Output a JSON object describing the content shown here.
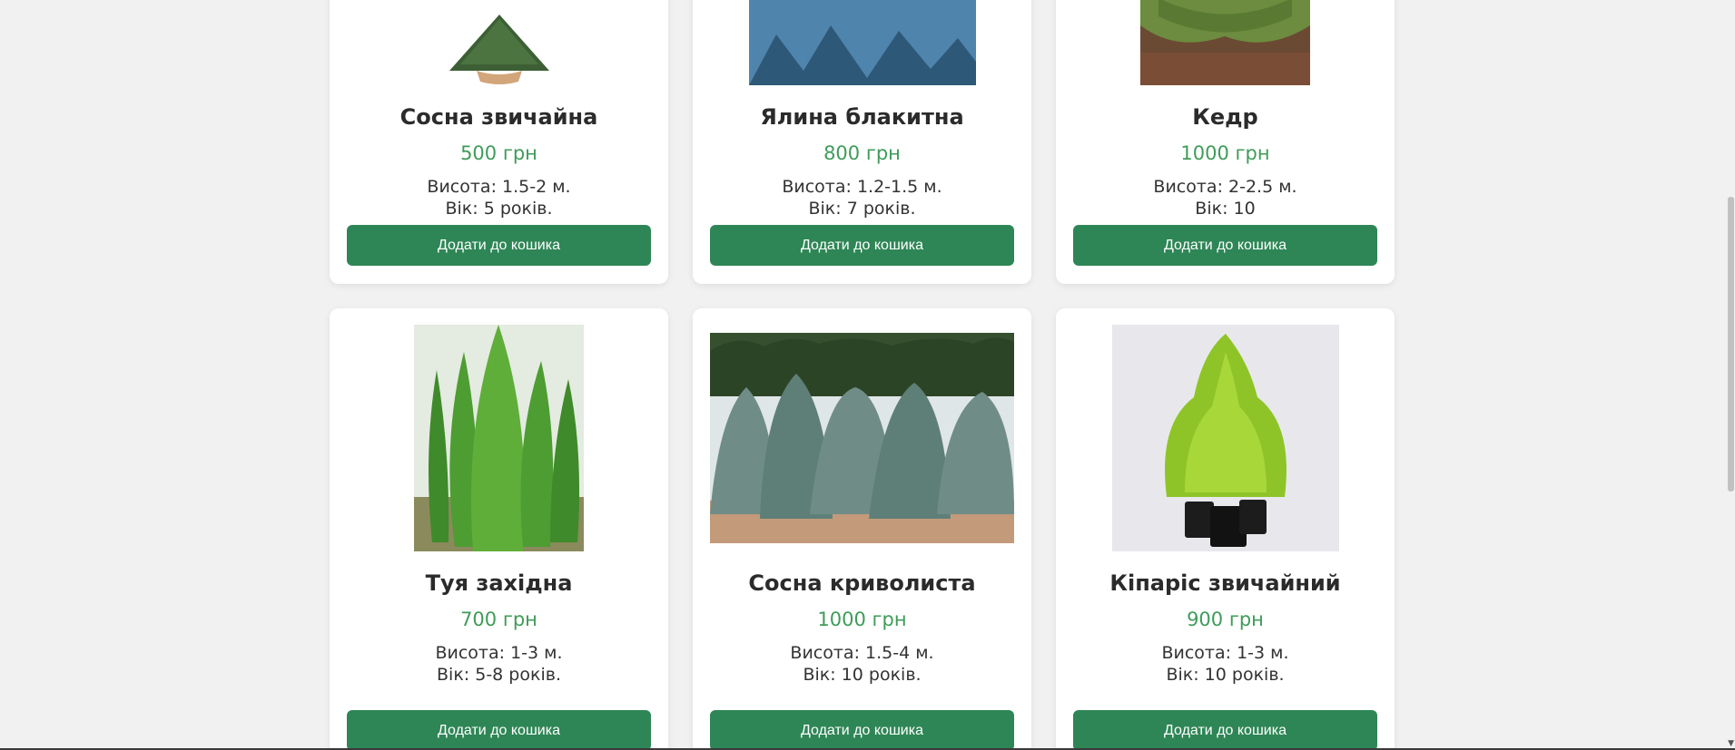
{
  "products": [
    {
      "name": "Сосна звичайна",
      "price": "500 грн",
      "height": "Висота: 1.5-2 м.",
      "age": "Вік: 5 років.",
      "button": "Додати до кошика",
      "image": "pine-tree-image"
    },
    {
      "name": "Ялина блакитна",
      "price": "800 грн",
      "height": "Висота: 1.2-1.5 м.",
      "age": "Вік: 7 років.",
      "button": "Додати до кошика",
      "image": "blue-spruce-image"
    },
    {
      "name": "Кедр",
      "price": "1000 грн",
      "height": "Висота: 2-2.5 м.",
      "age": "Вік: 10",
      "button": "Додати до кошика",
      "image": "cedar-image"
    },
    {
      "name": "Туя західна",
      "price": "700 грн",
      "height": "Висота: 1-3 м.",
      "age": "Вік: 5-8 років.",
      "button": "Додати до кошика",
      "image": "thuja-image"
    },
    {
      "name": "Сосна криволиста",
      "price": "1000 грн",
      "height": "Висота: 1.5-4 м.",
      "age": "Вік: 10 років.",
      "button": "Додати до кошика",
      "image": "lodgepole-pine-image"
    },
    {
      "name": "Кіпаріс звичайний",
      "price": "900 грн",
      "height": "Висота: 1-3 м.",
      "age": "Вік: 10 років.",
      "button": "Додати до кошика",
      "image": "cypress-image"
    }
  ],
  "colors": {
    "accent": "#2e8656",
    "price": "#3f9c5a",
    "background": "#f1f1f1"
  }
}
